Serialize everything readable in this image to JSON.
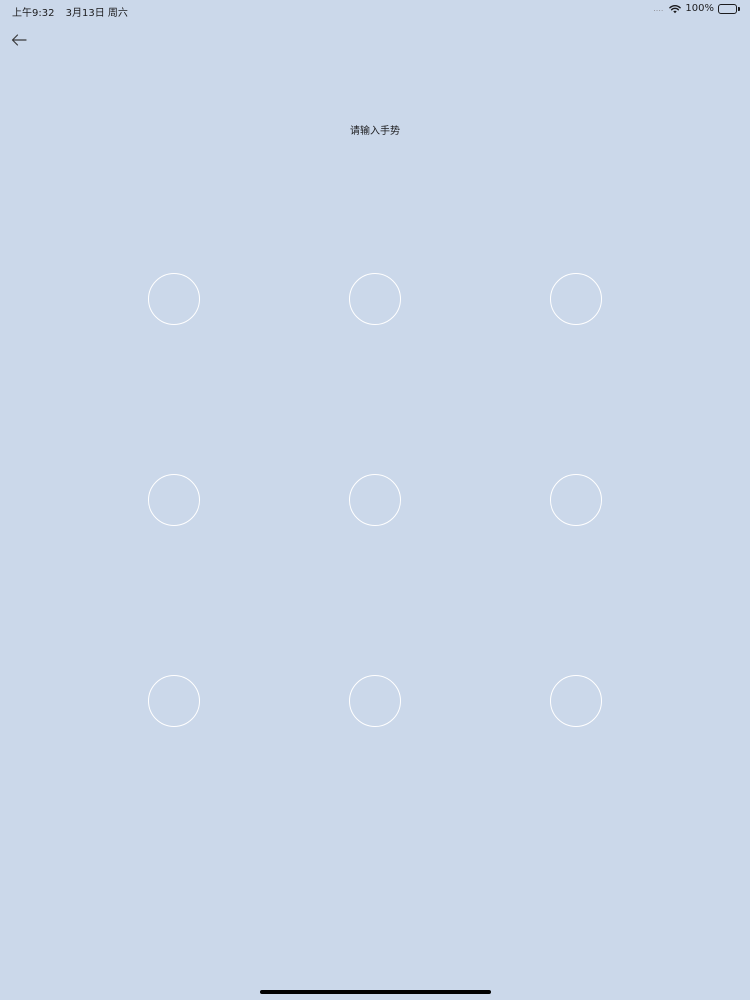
{
  "status_bar": {
    "time": "上午9:32",
    "date": "3月13日 周六",
    "signal": "....",
    "wifi_icon": "wifi-icon",
    "battery_percent": "100%",
    "battery_level": 1.0
  },
  "nav": {
    "back_icon": "arrow-left-icon"
  },
  "prompt": {
    "text": "请输入手势"
  },
  "pattern": {
    "rows": 3,
    "cols": 3,
    "dot_color": "#ffffff"
  },
  "colors": {
    "background": "#cbd8ea",
    "text": "#1c1c1e"
  }
}
